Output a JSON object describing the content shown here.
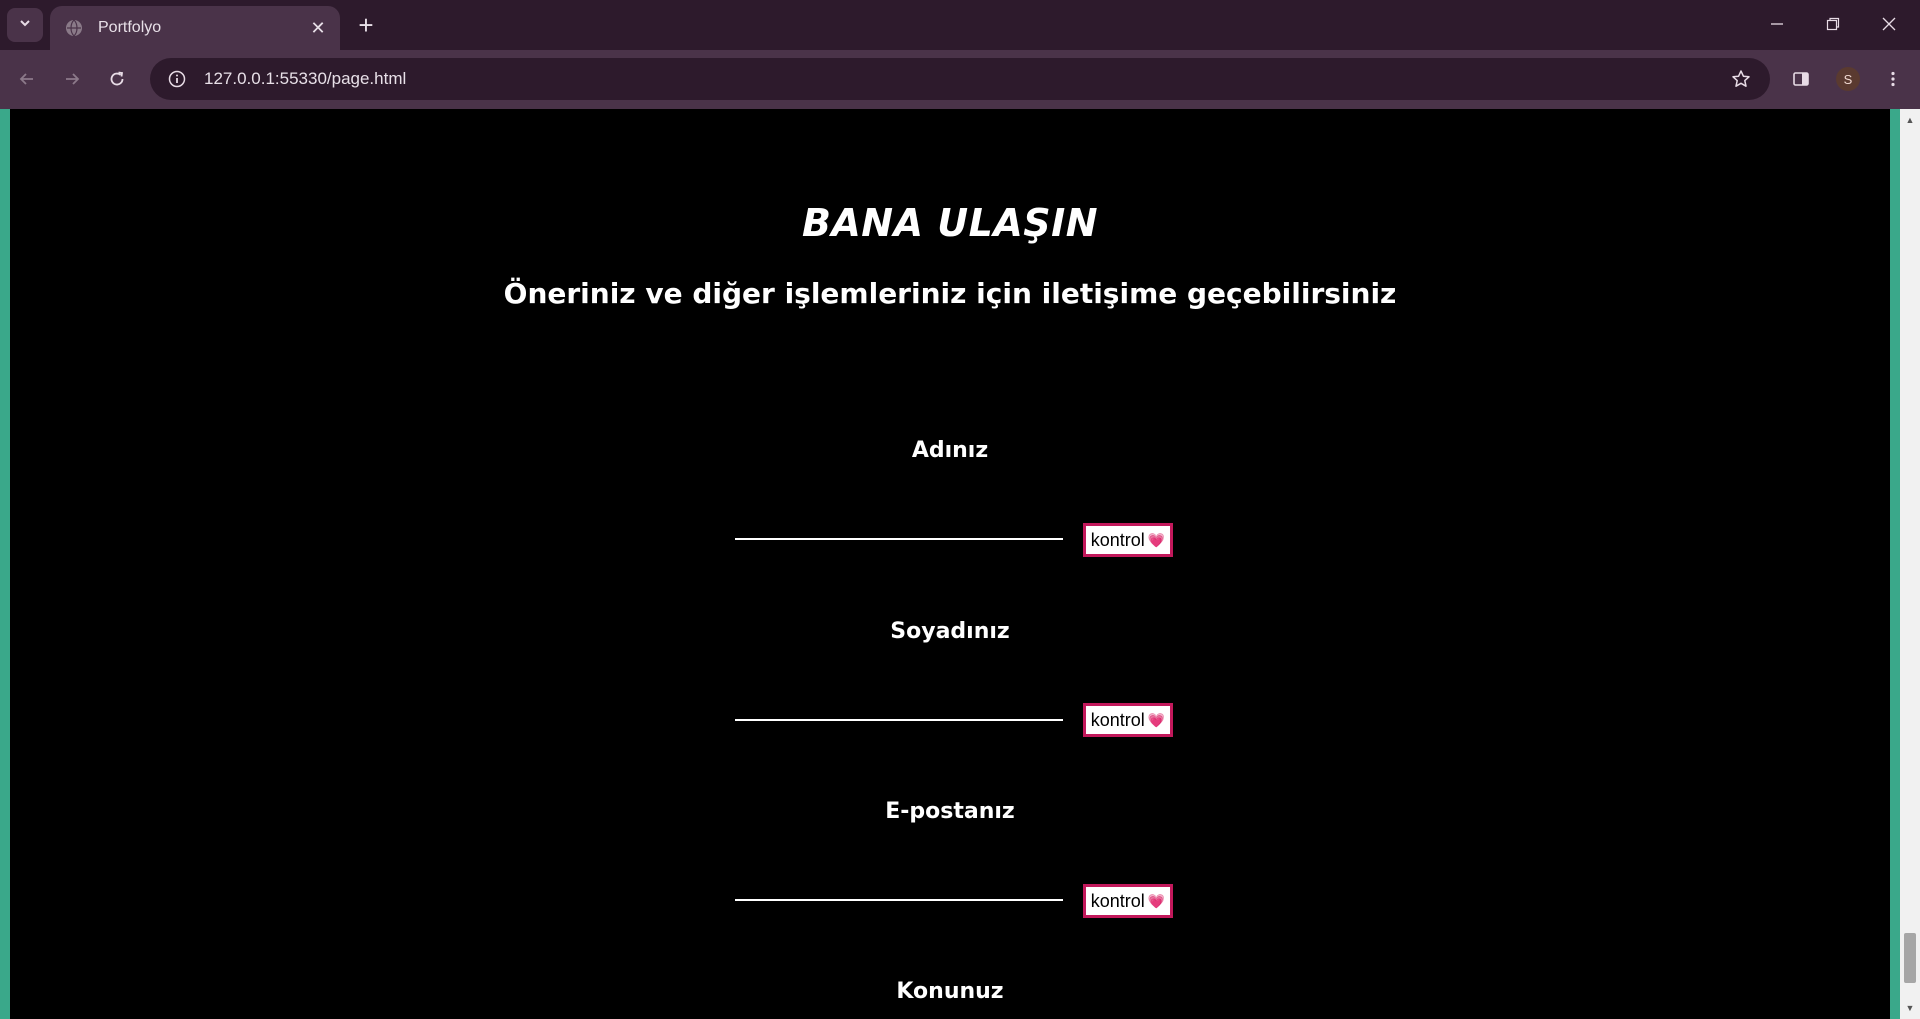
{
  "browser": {
    "tab_title": "Portfolyo",
    "url": "127.0.0.1:55330/page.html",
    "profile_initial": "S"
  },
  "page": {
    "heading": "BANA ULAŞIN",
    "subheading": "Öneriniz ve diğer işlemleriniz için iletişime geçebilirsiniz",
    "fields": [
      {
        "label": "Adınız",
        "button_text": "kontrol",
        "value": ""
      },
      {
        "label": "Soyadınız",
        "button_text": "kontrol",
        "value": ""
      },
      {
        "label": "E-postanız",
        "button_text": "kontrol",
        "value": ""
      },
      {
        "label": "Konunuz"
      }
    ],
    "heart_emoji": "💗"
  },
  "colors": {
    "side_accent": "#3aa88a",
    "button_border": "#c2185b",
    "chrome_dark": "#2d1a2c",
    "chrome_mid": "#4a3349"
  }
}
